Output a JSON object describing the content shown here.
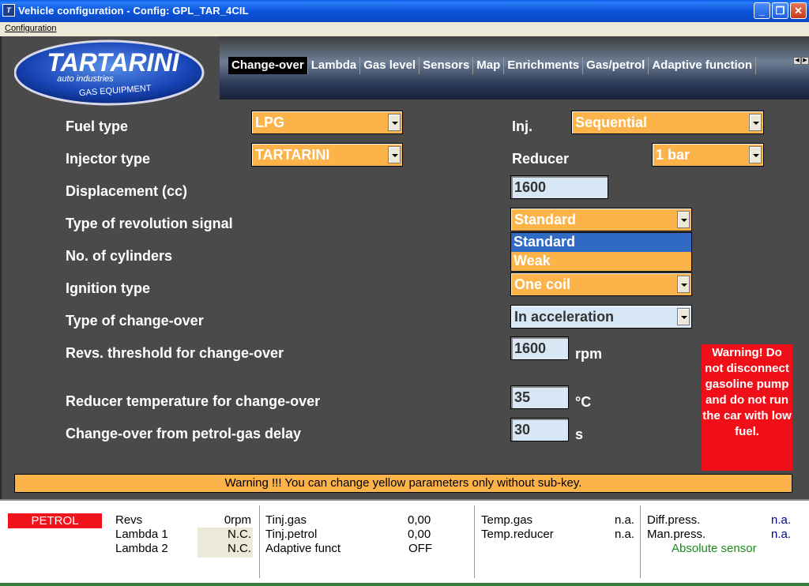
{
  "window": {
    "title": "Vehicle configuration - Config: GPL_TAR_4CIL",
    "menu": "Configuration"
  },
  "logo": {
    "brand": "TARTARINI",
    "sub1": "auto industries",
    "sub2": "GAS EQUIPMENT"
  },
  "tabs": [
    "Change-over",
    "Lambda",
    "Gas level",
    "Sensors",
    "Map",
    "Enrichments",
    "Gas/petrol",
    "Adaptive function"
  ],
  "form": {
    "fuel_type_label": "Fuel type",
    "fuel_type_value": "LPG",
    "inj_label": "Inj.",
    "inj_value": "Sequential",
    "injector_type_label": "Injector type",
    "injector_type_value": "TARTARINI",
    "reducer_label": "Reducer",
    "reducer_value": "1 bar",
    "displacement_label": "Displacement (cc)",
    "displacement_value": "1600",
    "rev_signal_label": "Type of revolution signal",
    "rev_signal_value": "Standard",
    "rev_signal_options": [
      "Standard",
      "Weak"
    ],
    "cylinders_label": "No. of cylinders",
    "ignition_label": "Ignition type",
    "ignition_value": "One coil",
    "changeover_type_label": "Type of change-over",
    "changeover_type_value": "In acceleration",
    "revs_threshold_label": "Revs. threshold for change-over",
    "revs_threshold_value": "1600",
    "revs_threshold_unit": "rpm",
    "reducer_temp_label": "Reducer temperature for change-over",
    "reducer_temp_value": "35",
    "reducer_temp_unit": "°C",
    "delay_label": "Change-over from petrol-gas delay",
    "delay_value": "30",
    "delay_unit": "s"
  },
  "warning_box": "Warning! Do not disconnect gasoline pump and do not run the car with low fuel.",
  "warning_bar": "Warning !!! You can change yellow parameters only without sub-key.",
  "status": {
    "mode": "PETROL",
    "revs_label": "Revs",
    "revs_value": "0rpm",
    "lambda1_label": "Lambda 1",
    "lambda1_value": "N.C.",
    "lambda2_label": "Lambda 2",
    "lambda2_value": "N.C.",
    "tinj_gas_label": "Tinj.gas",
    "tinj_gas_value": "0,00",
    "tinj_petrol_label": "Tinj.petrol",
    "tinj_petrol_value": "0,00",
    "adaptive_label": "Adaptive funct",
    "adaptive_value": "OFF",
    "temp_gas_label": "Temp.gas",
    "temp_gas_value": "n.a.",
    "temp_reducer_label": "Temp.reducer",
    "temp_reducer_value": "n.a.",
    "diff_press_label": "Diff.press.",
    "diff_press_value": "n.a.",
    "man_press_label": "Man.press.",
    "man_press_value": "n.a.",
    "sensor_label": "Absolute sensor"
  },
  "colors": {
    "yellow_param": "#fcb34a",
    "blue_param": "#d7e7f6",
    "warning_red": "#f00f19",
    "panel_bg": "#4a4a4a",
    "sensor_green": "#1a8a1a",
    "value_blue": "#00008b"
  }
}
